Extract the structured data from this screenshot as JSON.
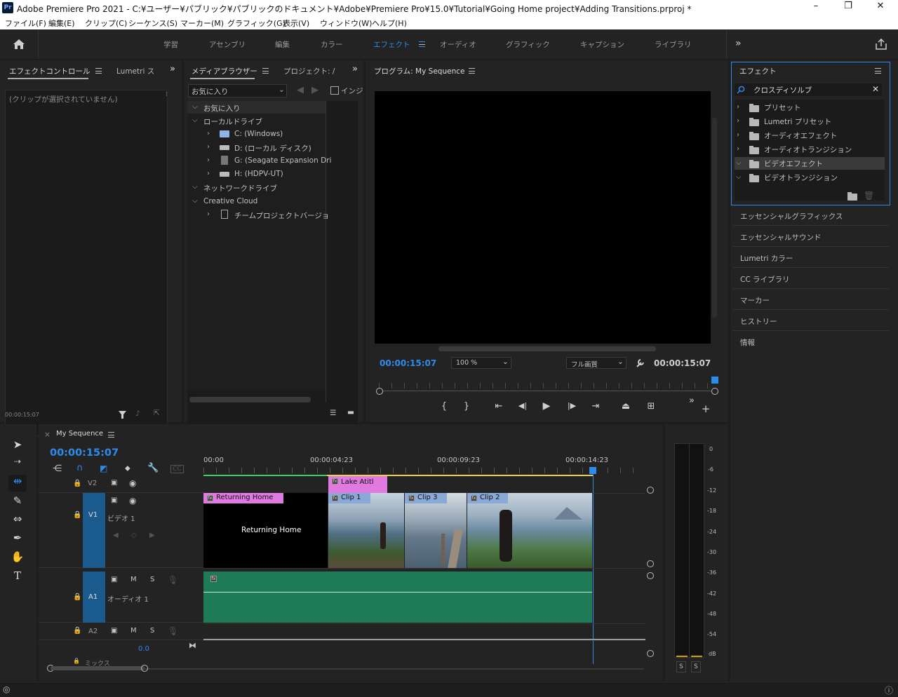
{
  "window": {
    "title": "Adobe Premiere Pro 2021 - C:¥ユーザー¥パブリック¥パブリックのドキュメント¥Adobe¥Premiere Pro¥15.0¥Tutorial¥Going Home project¥Adding Transitions.prproj *",
    "app_icon": "Pr",
    "min": "–",
    "max": "❐",
    "close": "✕"
  },
  "menu": [
    "ファイル(F)",
    "編集(E)",
    "クリップ(C)",
    "シーケンス(S)",
    "マーカー(M)",
    "グラフィック(G)",
    "表示(V)",
    "ウィンドウ(W)",
    "ヘルプ(H)"
  ],
  "workspaces": [
    "学習",
    "アセンブリ",
    "編集",
    "カラー",
    "エフェクト",
    "オーディオ",
    "グラフィック",
    "キャプション",
    "ライブラリ"
  ],
  "active_workspace": "エフェクト",
  "effect_controls": {
    "tab1": "エフェクトコントロール",
    "tab2": "Lumetri ス",
    "no_clip": "(クリップが選択されていません)",
    "timecode": "00:00:15:07"
  },
  "media_browser": {
    "tab1": "メディアブラウザー",
    "tab2": "プロジェクト: /",
    "dropdown": "お気に入り",
    "ingest_label": "インジ",
    "tree": [
      {
        "label": "お気に入り",
        "level": 0,
        "open": true
      },
      {
        "label": "ローカルドライブ",
        "level": 0,
        "open": true
      },
      {
        "label": "C: (Windows)",
        "level": 1
      },
      {
        "label": "D: (ローカル ディスク)",
        "level": 1
      },
      {
        "label": "G: (Seagate Expansion Dri",
        "level": 1
      },
      {
        "label": "H: (HDPV-UT)",
        "level": 1
      },
      {
        "label": "ネットワークドライブ",
        "level": 0,
        "open": true
      },
      {
        "label": "Creative Cloud",
        "level": 0,
        "open": true
      },
      {
        "label": "チームプロジェクトバージョ",
        "level": 1
      }
    ]
  },
  "program": {
    "title": "プログラム: My Sequence",
    "timecode_left": "00:00:15:07",
    "zoom": "100 %",
    "quality": "フル画質",
    "timecode_right": "00:00:15:07"
  },
  "effects": {
    "title": "エフェクト",
    "search": "クロスディソルブ",
    "items": [
      "プリセット",
      "Lumetri プリセット",
      "オーディオエフェクト",
      "オーディオトランジション",
      "ビデオエフェクト",
      "ビデオトランジション"
    ]
  },
  "right_list": [
    "エッセンシャルグラフィックス",
    "エッセンシャルサウンド",
    "Lumetri カラー",
    "CC ライブラリ",
    "マーカー",
    "ヒストリー",
    "情報"
  ],
  "timeline": {
    "title": "My Sequence",
    "timecode": "00:00:15:07",
    "ruler": [
      "00:00",
      "00:00:04:23",
      "00:00:09:23",
      "00:00:14:23"
    ],
    "tracks": {
      "v2": "V2",
      "v1": "V1",
      "v1_name": "ビデオ 1",
      "a1": "A1",
      "a1_name": "オーディオ 1",
      "a2": "A2",
      "mix": "ミックス",
      "mix_val": "0.0",
      "m": "M",
      "s": "S"
    },
    "clips": {
      "returning": "Returning Home",
      "returning_text": "Returning Home",
      "lake": "Lake Atitl",
      "clip1": "Clip 1",
      "clip3": "Clip 3",
      "clip2": "Clip 2"
    }
  },
  "meter": {
    "labels": [
      "0",
      "-6",
      "-12",
      "-18",
      "-24",
      "-30",
      "-36",
      "-42",
      "-48",
      "-54",
      "dB"
    ],
    "s": "S"
  },
  "colors": {
    "accent": "#2d8ceb",
    "audio_clip": "#1f7a58",
    "graphic_clip": "#e07ae0",
    "video_clip_label": "#8aa9d6"
  }
}
